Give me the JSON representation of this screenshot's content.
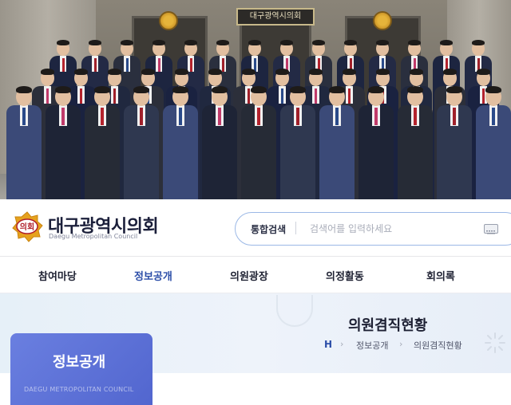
{
  "hero": {
    "building_sign": "대구광역시의회"
  },
  "header": {
    "logo_text": "대구광역시의회",
    "logo_subtitle": "Daegu Metropolitan Council",
    "logo_badge": "의회",
    "search": {
      "scope_label": "통합검색",
      "placeholder": "검색어를 입력하세요",
      "keyboard_icon": "keyboard-icon"
    }
  },
  "nav": {
    "items": [
      {
        "label": "참여마당",
        "active": false
      },
      {
        "label": "정보공개",
        "active": true
      },
      {
        "label": "의원광장",
        "active": false
      },
      {
        "label": "의정활동",
        "active": false
      },
      {
        "label": "회의록",
        "active": false
      }
    ]
  },
  "page": {
    "title": "의원겸직현황",
    "breadcrumb": {
      "home": "H",
      "items": [
        "정보공개",
        "의원겸직현황"
      ]
    }
  },
  "side": {
    "title": "정보공개",
    "subtitle": "DAEGU METROPOLITAN COUNCIL"
  },
  "colors": {
    "accent": "#2c4ea8",
    "side_tab": "#5b70d8",
    "logo_gold": "#e6a21e"
  }
}
